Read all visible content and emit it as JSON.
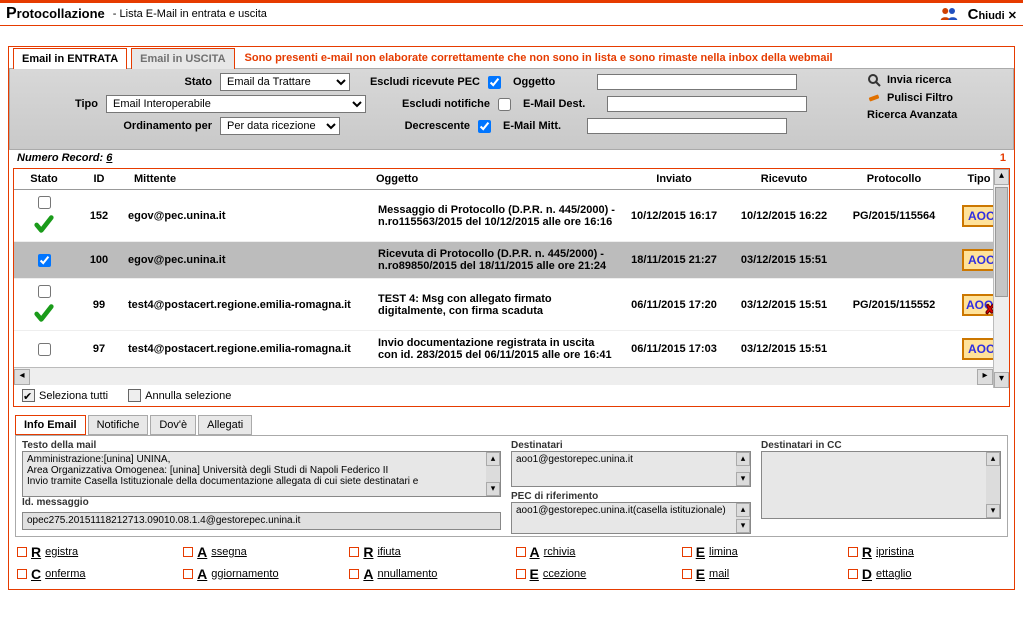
{
  "titlebar": {
    "app_big": "P",
    "app_rest": "rotocollazione",
    "subtitle": "- Lista E-Mail in entrata e uscita",
    "close_big": "C",
    "close_rest": "hiudi",
    "close_glyph": "✕"
  },
  "tabs": {
    "entrata": "Email in ENTRATA",
    "uscita": "Email in USCITA",
    "warning": "Sono presenti e-mail non elaborate correttamente che non sono in lista e sono rimaste nella inbox della webmail"
  },
  "filters": {
    "stato_label": "Stato",
    "stato_value": "Email da Trattare",
    "tipo_label": "Tipo",
    "tipo_value": "Email Interoperabile",
    "ord_label": "Ordinamento per",
    "ord_value": "Per data ricezione",
    "escl_pec": "Escludi ricevute PEC",
    "escl_notif": "Escludi notifiche",
    "decrescente": "Decrescente",
    "oggetto": "Oggetto",
    "email_dest": "E-Mail Dest.",
    "email_mitt": "E-Mail Mitt.",
    "invia_ricerca": "Invia ricerca",
    "pulisci": "Pulisci Filtro",
    "avanzata": "Ricerca Avanzata"
  },
  "records": {
    "label": "Numero Record:",
    "count": "6",
    "page": "1"
  },
  "grid": {
    "cols": {
      "stato": "Stato",
      "id": "ID",
      "mittente": "Mittente",
      "oggetto": "Oggetto",
      "inviato": "Inviato",
      "ricevuto": "Ricevuto",
      "protocollo": "Protocollo",
      "tipo": "Tipo"
    },
    "rows": [
      {
        "checked": false,
        "status": "ok",
        "id": "152",
        "mittente": "egov@pec.unina.it",
        "oggetto": "Messaggio di Protocollo (D.P.R. n. 445/2000) - n.ro115563/2015 del 10/12/2015 alle ore 16:16",
        "inviato": "10/12/2015 16:17",
        "ricevuto": "10/12/2015 16:22",
        "protocollo": "PG/2015/115564",
        "tipo": "AOO"
      },
      {
        "checked": true,
        "status": "none",
        "selected": true,
        "id": "100",
        "mittente": "egov@pec.unina.it",
        "oggetto": "Ricevuta di Protocollo (D.P.R. n. 445/2000) - n.ro89850/2015 del 18/11/2015 alle ore 21:24",
        "inviato": "18/11/2015 21:27",
        "ricevuto": "03/12/2015 15:51",
        "protocollo": "",
        "tipo": "AOO"
      },
      {
        "checked": false,
        "status": "ok",
        "id": "99",
        "mittente": "test4@postacert.regione.emilia-romagna.it",
        "oggetto": "TEST 4: Msg con allegato firmato digitalmente, con firma scaduta",
        "inviato": "06/11/2015 17:20",
        "ricevuto": "03/12/2015 15:51",
        "protocollo": "PG/2015/115552",
        "tipo": "AOOX"
      },
      {
        "checked": false,
        "status": "none",
        "id": "97",
        "mittente": "test4@postacert.regione.emilia-romagna.it",
        "oggetto": "Invio documentazione registrata in uscita con id. 283/2015 del 06/11/2015 alle ore 16:41",
        "inviato": "06/11/2015 17:03",
        "ricevuto": "03/12/2015 15:51",
        "protocollo": "",
        "tipo": "AOO"
      }
    ],
    "sel_tutti": "Seleziona tutti",
    "annulla": "Annulla selezione"
  },
  "detail": {
    "tabs": {
      "info": "Info Email",
      "notifiche": "Notifiche",
      "dove": "Dov'è",
      "allegati": "Allegati"
    },
    "testo_label": "Testo della mail",
    "testo_body": "Amministrazione:[unina] UNINA,\nArea Organizzativa Omogenea: [unina] Università degli Studi di Napoli Federico II\nInvio tramite Casella Istituzionale della documentazione allegata di cui siete destinatari e",
    "id_label": "Id. messaggio",
    "id_value": "opec275.20151118212713.09010.08.1.4@gestorepec.unina.it",
    "dest_label": "Destinatari",
    "dest_value": "aoo1@gestorepec.unina.it",
    "pec_label": "PEC di riferimento",
    "pec_value": "aoo1@gestorepec.unina.it(casella istituzionale)",
    "cc_label": "Destinatari in CC"
  },
  "actions_row1": [
    {
      "big": "R",
      "rest": "egistra"
    },
    {
      "big": "A",
      "rest": "ssegna"
    },
    {
      "big": "R",
      "rest": "ifiuta"
    },
    {
      "big": "A",
      "rest": "rchivia"
    },
    {
      "big": "E",
      "rest": "limina"
    },
    {
      "big": "R",
      "rest": "ipristina"
    }
  ],
  "actions_row2": [
    {
      "big": "C",
      "rest": "onferma"
    },
    {
      "big": "A",
      "rest": "ggiornamento"
    },
    {
      "big": "A",
      "rest": "nnullamento"
    },
    {
      "big": "E",
      "rest": "ccezione"
    },
    {
      "big": "E",
      "rest": "mail"
    },
    {
      "big": "D",
      "rest": "ettaglio"
    }
  ]
}
